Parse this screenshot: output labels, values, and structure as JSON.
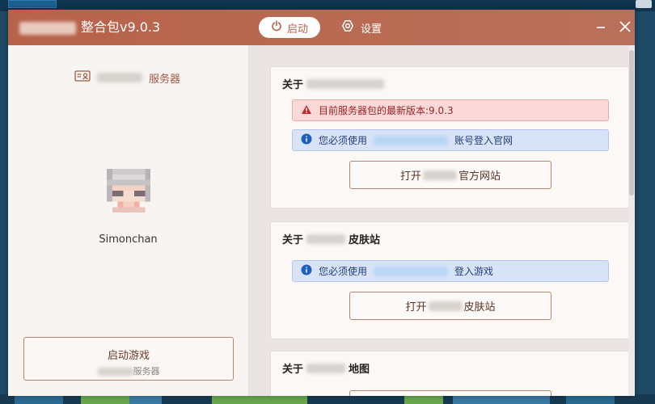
{
  "window": {
    "title_suffix": "整合包v9.0.3",
    "launch_label": "启动",
    "settings_label": "设置"
  },
  "sidebar": {
    "server_label": "服务器",
    "username": "Simonchan",
    "launch_game_label": "启动游戏",
    "launch_game_sub": "服务器"
  },
  "cards": [
    {
      "title": "关于",
      "alert_error": "目前服务器包的最新版本:9.0.3",
      "alert_info_prefix": "您必须使用",
      "alert_info_suffix": "账号登入官网",
      "button_prefix": "打开",
      "button_suffix": "官方网站"
    },
    {
      "title_prefix": "关于",
      "title_suffix": "皮肤站",
      "alert_info_prefix": "您必须使用",
      "alert_info_suffix": "登入游戏",
      "button_prefix": "打开",
      "button_suffix": "皮肤站"
    },
    {
      "title_prefix": "关于",
      "title_suffix": "地图"
    }
  ],
  "colors": {
    "accent": "#b8624a",
    "error_bg": "#fbd9d9",
    "info_bg": "#d9e3f7"
  }
}
